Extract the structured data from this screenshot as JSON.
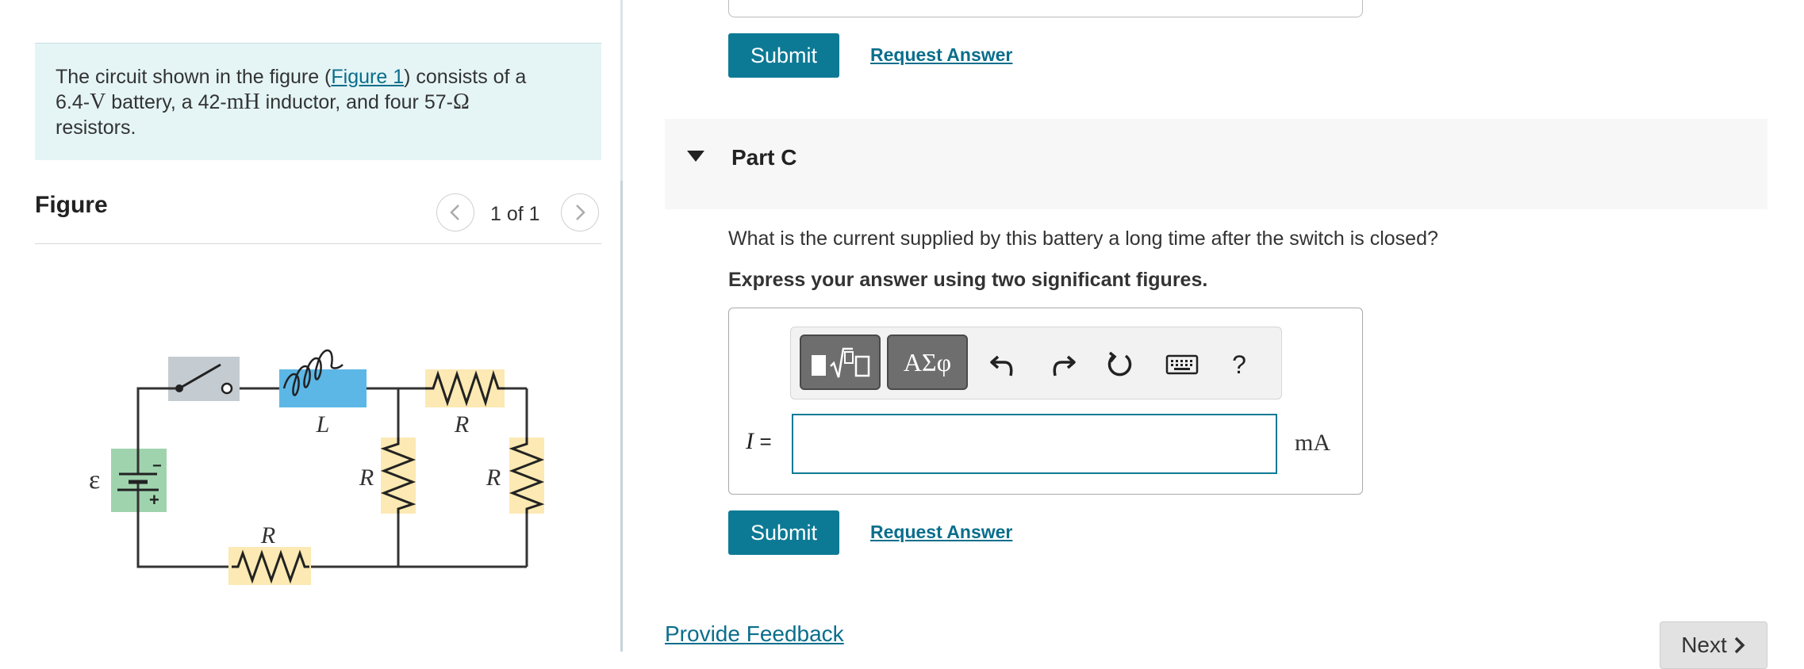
{
  "problem": {
    "text_before_link": "The circuit shown in the figure (",
    "figure_link": "Figure 1",
    "text_after_link": ") consists of a",
    "line2_a": "6.4-",
    "unit_v": "V",
    "line2_b": " battery, a 42-",
    "unit_mh": "mH",
    "line2_c": " inductor, and four 57-",
    "unit_ohm": "Ω",
    "line3": "resistors."
  },
  "figure": {
    "title": "Figure",
    "pager": "1 of 1",
    "labels": {
      "emf": "ε",
      "inductor": "L",
      "resistor": "R"
    },
    "battery_minus": "−",
    "battery_plus": "+"
  },
  "top_actions": {
    "submit": "Submit",
    "request": "Request Answer"
  },
  "part_c": {
    "title": "Part C",
    "question": "What is the current supplied by this battery a long time after the switch is closed?",
    "instruction": "Express your answer using two significant figures.",
    "toolbar": {
      "greek": "ΑΣφ",
      "help": "?"
    },
    "variable": "I",
    "equals": "=",
    "input_value": "",
    "unit": "mA",
    "submit": "Submit",
    "request": "Request Answer"
  },
  "footer": {
    "feedback": "Provide Feedback",
    "next": "Next"
  },
  "colors": {
    "accent": "#0d7a95",
    "problem_bg": "#e5f5f6",
    "switch_bg": "#c4ccd2",
    "inductor_bg": "#5cb7e6",
    "resistor_bg": "#fce9b3",
    "battery_bg": "#9fd3ad"
  }
}
